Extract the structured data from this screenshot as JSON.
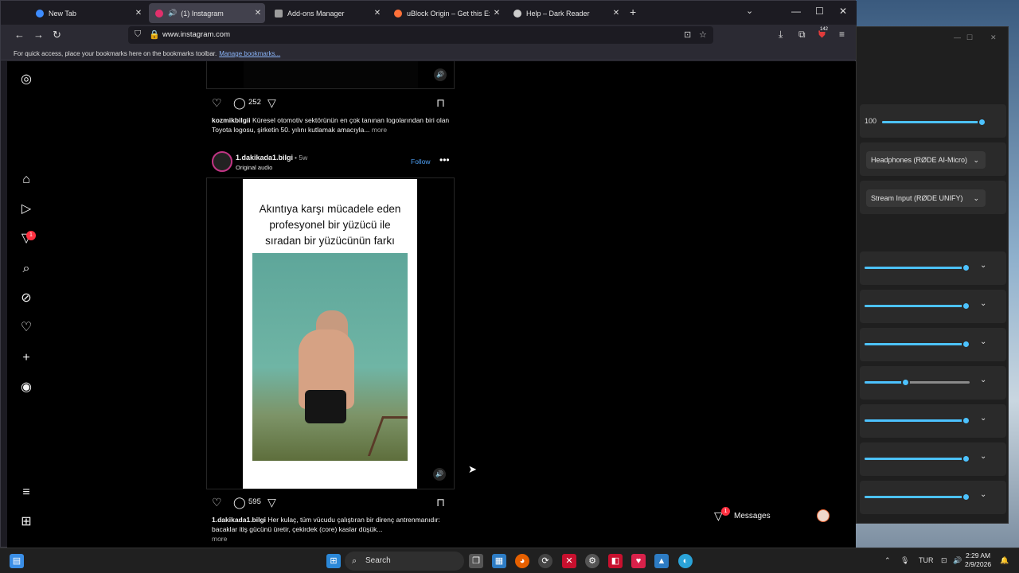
{
  "browser": {
    "tabs": [
      {
        "title": "New Tab",
        "favicon_color": "#3d8cff"
      },
      {
        "title": "(1) Instagram",
        "favicon_color": "#e1306c",
        "active": true,
        "sound": "speaker-icon"
      },
      {
        "title": "Add-ons Manager",
        "favicon_color": "#9c9c9c"
      },
      {
        "title": "uBlock Origin – Get this Extension",
        "favicon_color": "#ff7139"
      },
      {
        "title": "Help – Dark Reader",
        "favicon_color": "#cccccc"
      }
    ],
    "new_tab": "+",
    "url": "www.instagram.com",
    "extension_badge": "142",
    "bookmarks_text": "For quick access, place your bookmarks here on the bookmarks toolbar.",
    "bookmarks_link": "Manage bookmarks..."
  },
  "post1": {
    "comments": "252",
    "username": "kozmikbilgii",
    "caption": "Küresel otomotiv sektörünün en çok tanınan logolarından biri olan Toyota logosu, şirketin 50. yılını kutlamak amacıyla...",
    "more": "more"
  },
  "post2": {
    "username": "1.dakikada1.bilgi",
    "age": "• 5w",
    "audio": "Original audio",
    "follow": "Follow",
    "video_lines": [
      "Akıntıya karşı mücadele eden",
      "profesyonel bir yüzücü ile",
      "sıradan bir yüzücünün farkı"
    ],
    "comments": "595",
    "caption": "Her kulaç, tüm vücudu çalıştıran bir direnç antrenmanıdır: bacaklar itiş gücünü üretir, çekirdek (core) kaslar düşük...",
    "more": "more"
  },
  "sidebar": {
    "notification_count": "1"
  },
  "messages": {
    "label": "Messages",
    "badge": "1"
  },
  "sound_panel": {
    "master_volume": "100",
    "master_level": 1.0,
    "output_device": "Headphones (RØDE AI-Micro)",
    "input_device": "Stream Input (RØDE UNIFY)",
    "app_levels": [
      1.0,
      1.0,
      1.0,
      0.4,
      1.0,
      1.0,
      1.0
    ]
  },
  "taskbar": {
    "search": "Search",
    "language": "TUR",
    "time": "2:29 AM",
    "date": "2/9/2026"
  }
}
